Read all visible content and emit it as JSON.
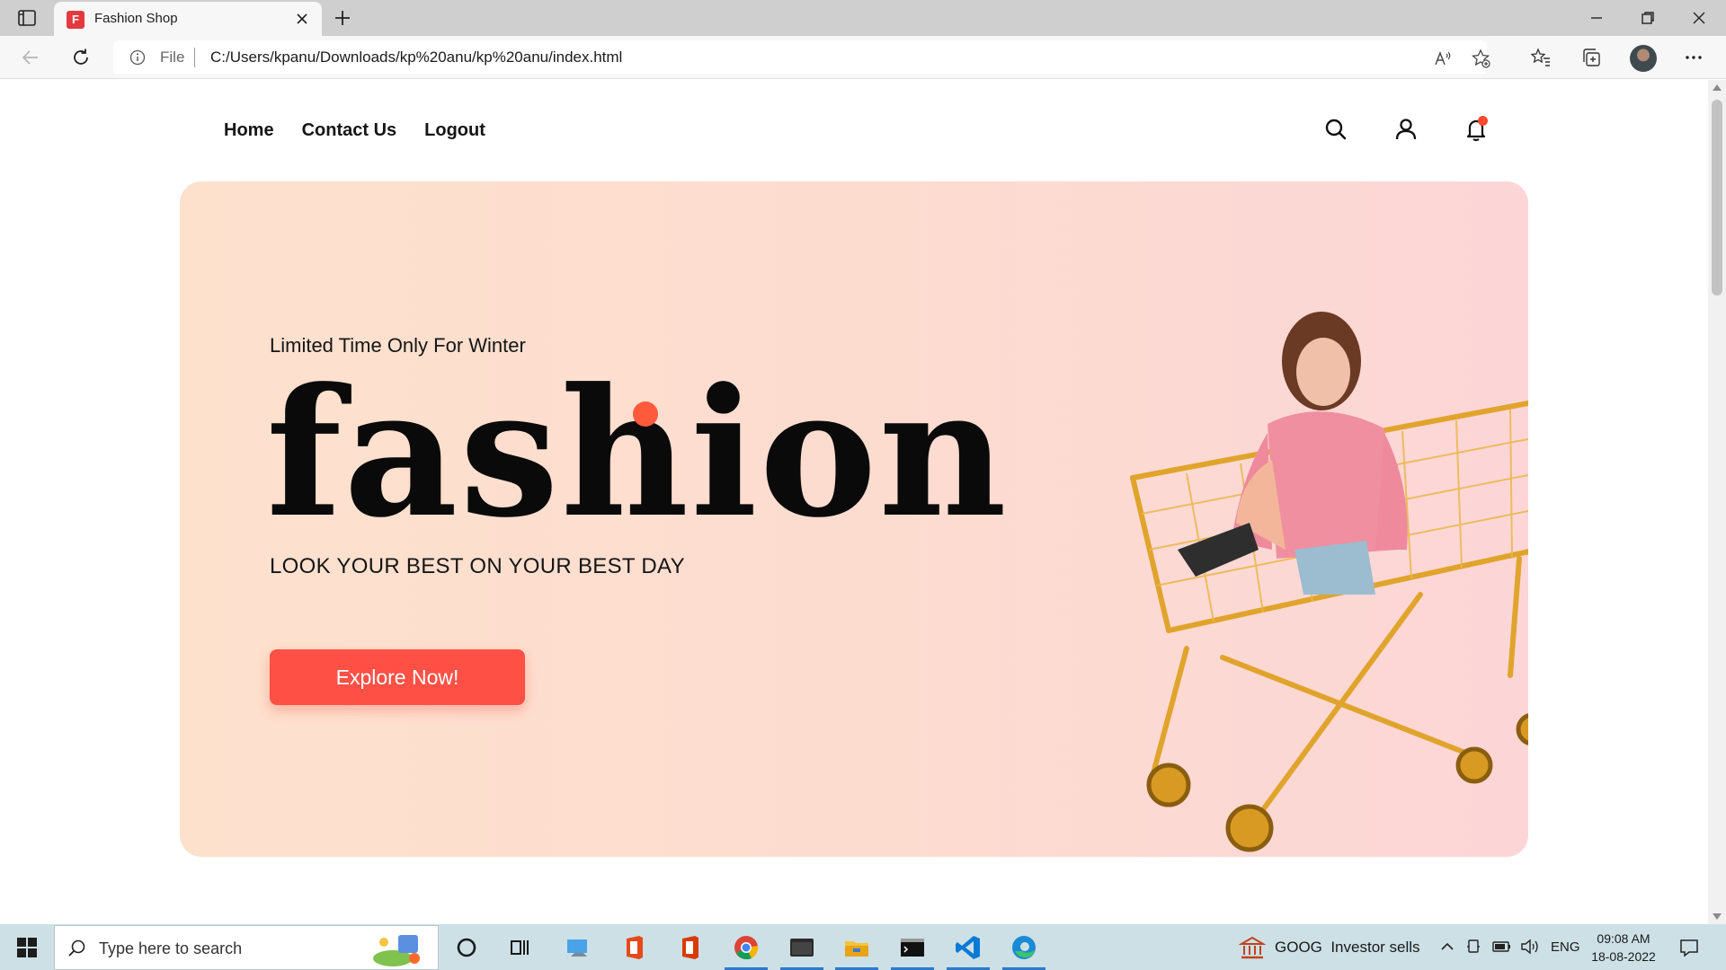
{
  "browser": {
    "tab_title": "Fashion Shop",
    "favicon_letter": "F",
    "address_label": "File",
    "url": "C:/Users/kpanu/Downloads/kp%20anu/kp%20anu/index.html"
  },
  "site": {
    "nav": [
      "Home",
      "Contact Us",
      "Logout"
    ],
    "icons": [
      "search-icon",
      "user-icon",
      "bell-icon"
    ],
    "accent_color": "#ff5045"
  },
  "hero": {
    "eyebrow": "Limited Time Only For Winter",
    "brand": "fashion",
    "tagline": "LOOK YOUR BEST ON YOUR BEST DAY",
    "cta": "Explore Now!"
  },
  "taskbar": {
    "search_placeholder": "Type here to search",
    "news_ticker": "GOOG  Investor sells",
    "lang": "ENG",
    "time": "09:08 AM",
    "date": "18-08-2022"
  }
}
